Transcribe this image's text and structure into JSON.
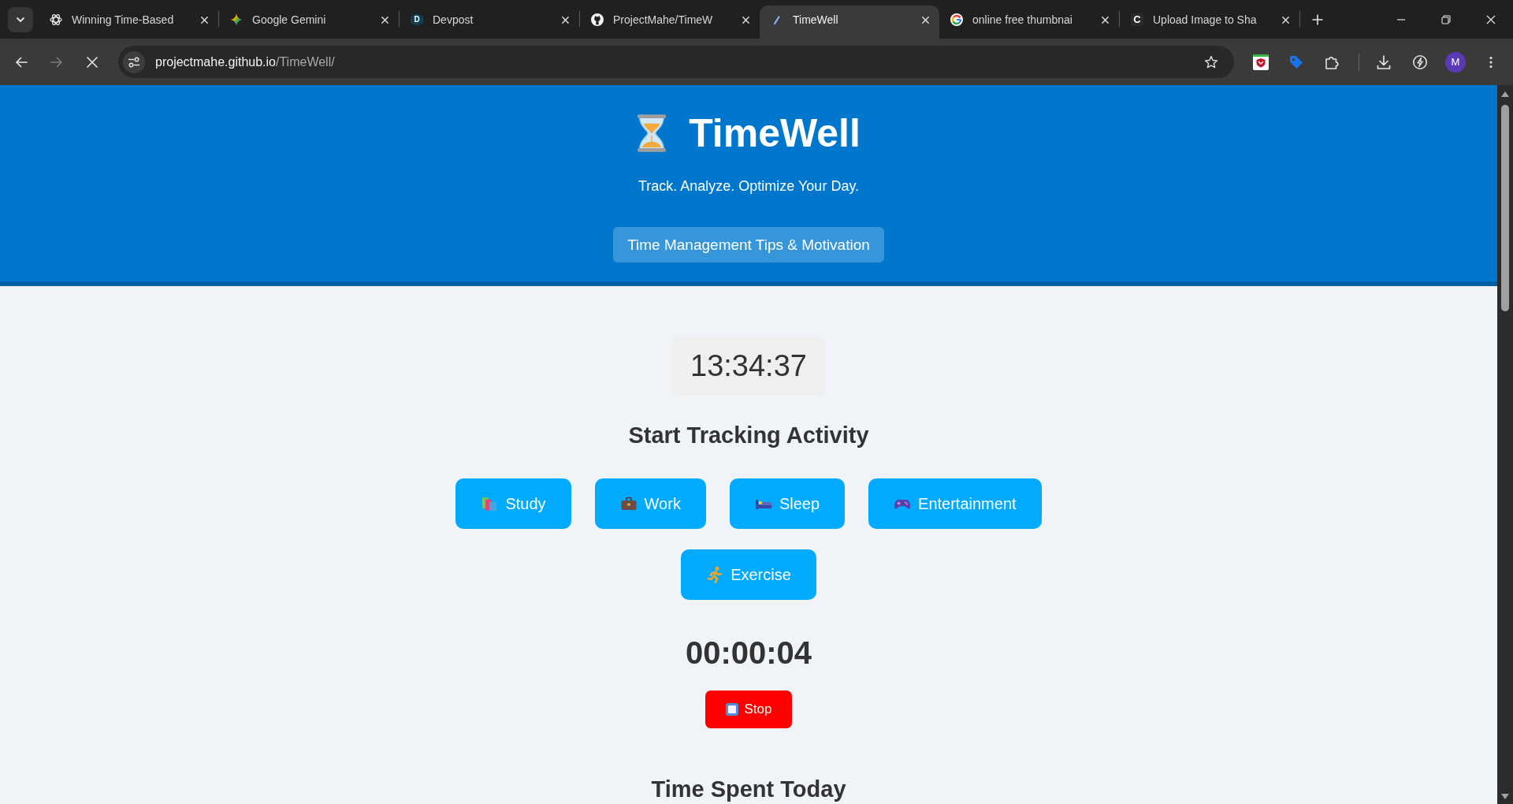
{
  "browser": {
    "tabs": [
      {
        "title": "Winning Time-Based",
        "kind": "knot",
        "selected": false
      },
      {
        "title": "Google Gemini",
        "kind": "sparkle",
        "selected": false
      },
      {
        "title": "Devpost",
        "kind": "hexagon",
        "icon_text": "D",
        "selected": false
      },
      {
        "title": "ProjectMahe/TimeW",
        "kind": "cat",
        "selected": false
      },
      {
        "title": "TimeWell",
        "kind": "stroke",
        "selected": true
      },
      {
        "title": "online free thumbnai",
        "kind": "ring",
        "selected": false
      },
      {
        "title": "Upload Image to Sha",
        "kind": "square",
        "icon_text": "C",
        "selected": false
      }
    ],
    "navigation": {
      "back_disabled": false,
      "forward_disabled": true,
      "loading": true
    },
    "address_bar": {
      "host": "projectmahe.github.io",
      "path": "/TimeWell/"
    },
    "profile": {
      "initial": "M"
    }
  },
  "header": {
    "title": "TimeWell",
    "tagline": "Track. Analyze. Optimize Your Day.",
    "tips_button": "Time Management Tips & Motivation"
  },
  "clock": "13:34:37",
  "tracking": {
    "heading": "Start Tracking Activity",
    "activities": [
      {
        "label": "Study",
        "kind": "books"
      },
      {
        "label": "Work",
        "kind": "briefcase"
      },
      {
        "label": "Sleep",
        "kind": "bed"
      },
      {
        "label": "Entertainment",
        "kind": "gamepad"
      },
      {
        "label": "Exercise",
        "kind": "runner"
      }
    ],
    "timer": "00:00:04",
    "stop_button": "Stop"
  },
  "summary": {
    "heading": "Time Spent Today"
  }
}
